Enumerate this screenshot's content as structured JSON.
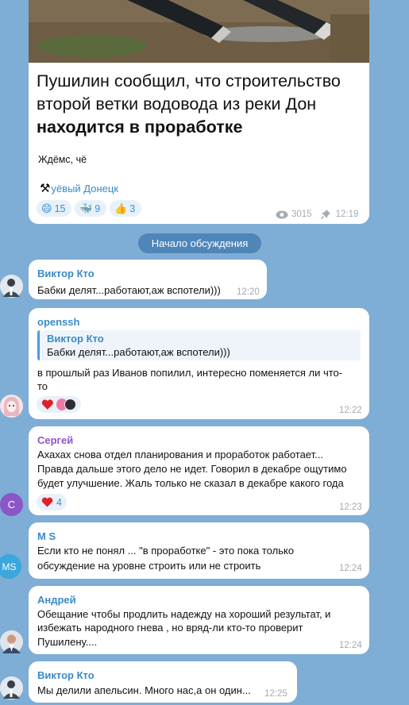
{
  "post": {
    "headline_line1": "Пушилин сообщил, что строительство",
    "headline_line2": "второй ветки водовода из реки Дон",
    "headline_line3": "находится в проработке",
    "comment": "Ждёмс, чё",
    "channel": "уёвый Донецк",
    "reactions": [
      {
        "icon": "grin-emoji-icon",
        "count": "15"
      },
      {
        "icon": "whale-emoji-icon",
        "count": "9"
      },
      {
        "icon": "thumbs-up-emoji-icon",
        "count": "3"
      }
    ],
    "views": "3015",
    "time": "12:19"
  },
  "divider": "Начало обсуждения",
  "messages": [
    {
      "author": "Виктор Кто",
      "author_color": "#3a8bc7",
      "lines": [
        "Бабки делят...работают,аж вспотели)))"
      ],
      "time": "12:20"
    },
    {
      "author": "openssh",
      "author_color": "#3a8bc7",
      "reply_author": "Виктор Кто",
      "reply_text": "Бабки делят...работают,аж вспотели)))",
      "lines": [
        "в прошлый раз Иванов попилил, интересно поменяется ли что-",
        "то"
      ],
      "time": "12:22"
    },
    {
      "author": "Сергей",
      "author_color": "#8c55c8",
      "lines": [
        "Ахахах снова отдел планирования и проработок работает...",
        "Правда дальше этого дело не идет. Говорил в декабре ощутимо",
        "будет улучшение. Жаль только не сказал в декабре какого года"
      ],
      "reaction_count": "4",
      "time": "12:23"
    },
    {
      "author": "M S",
      "author_color": "#3a8bc7",
      "avatar_text": "MS",
      "lines": [
        "Если кто не понял ... \"в проработке\" - это пока только",
        "обсуждение на уровне строить или не строить"
      ],
      "time": "12:24"
    },
    {
      "author": "Андрей",
      "author_color": "#3a8bc7",
      "lines": [
        "Обещание чтобы продлить надежду на хороший результат, и",
        "избежать народного гнева , но вряд-ли кто-то проверит",
        "Пушилену...."
      ],
      "time": "12:24"
    },
    {
      "author": "Виктор Кто",
      "author_color": "#3a8bc7",
      "lines": [
        "Мы делили апельсин. Много нас,а он один..."
      ],
      "time": "12:25"
    }
  ],
  "avatars": {
    "sergey": "С"
  },
  "colors": {
    "accent": "#3a8bc7",
    "background": "#7eadd6",
    "divider_bg": "#4f86b8"
  }
}
